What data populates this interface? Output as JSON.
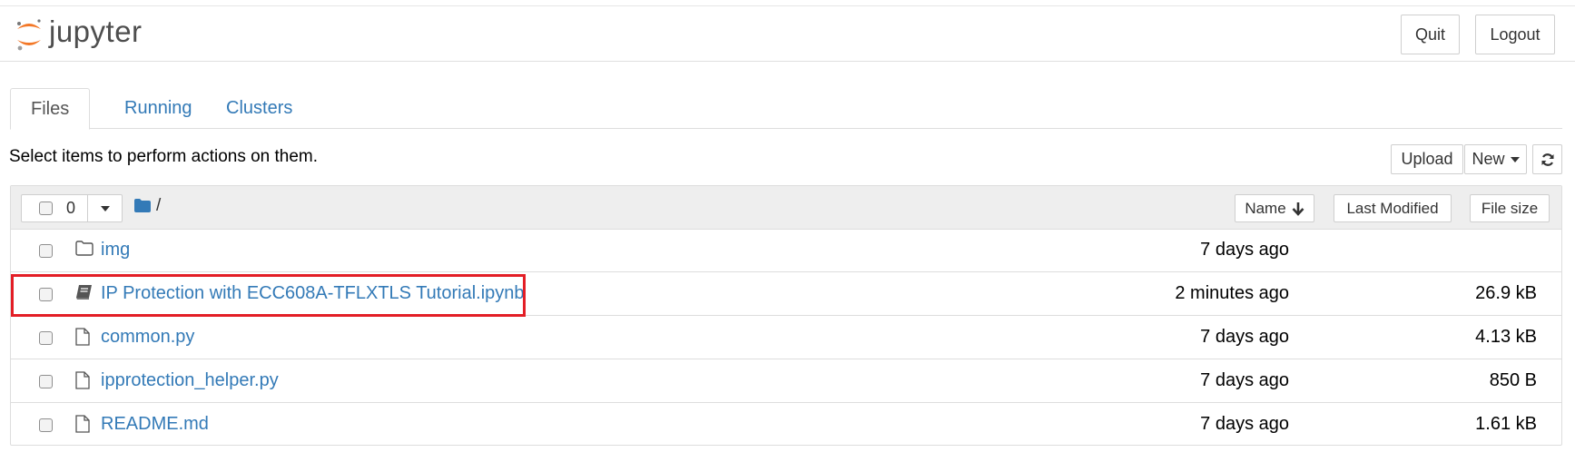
{
  "app": {
    "logo_text": "jupyter",
    "quit_label": "Quit",
    "logout_label": "Logout"
  },
  "tabs": [
    {
      "label": "Files",
      "active": true
    },
    {
      "label": "Running",
      "active": false
    },
    {
      "label": "Clusters",
      "active": false
    }
  ],
  "toolbar": {
    "instructions": "Select items to perform actions on them.",
    "upload_label": "Upload",
    "new_label": "New",
    "refresh_icon": "refresh-icon"
  },
  "list_header": {
    "selected_count": "0",
    "path": "/",
    "name_label": "Name",
    "last_modified_label": "Last Modified",
    "file_size_label": "File size"
  },
  "files": [
    {
      "name": "img",
      "icon": "folder-icon",
      "modified": "7 days ago",
      "size": ""
    },
    {
      "name": "IP Protection with ECC608A-TFLXTLS Tutorial.ipynb",
      "icon": "notebook-icon",
      "modified": "2 minutes ago",
      "size": "26.9 kB"
    },
    {
      "name": "common.py",
      "icon": "file-icon",
      "modified": "7 days ago",
      "size": "4.13 kB"
    },
    {
      "name": "ipprotection_helper.py",
      "icon": "file-icon",
      "modified": "7 days ago",
      "size": "850 B"
    },
    {
      "name": "README.md",
      "icon": "file-icon",
      "modified": "7 days ago",
      "size": "1.61 kB"
    }
  ],
  "colors": {
    "link": "#337ab7",
    "highlight": "#e31e26",
    "logo_orange": "#f37726"
  }
}
